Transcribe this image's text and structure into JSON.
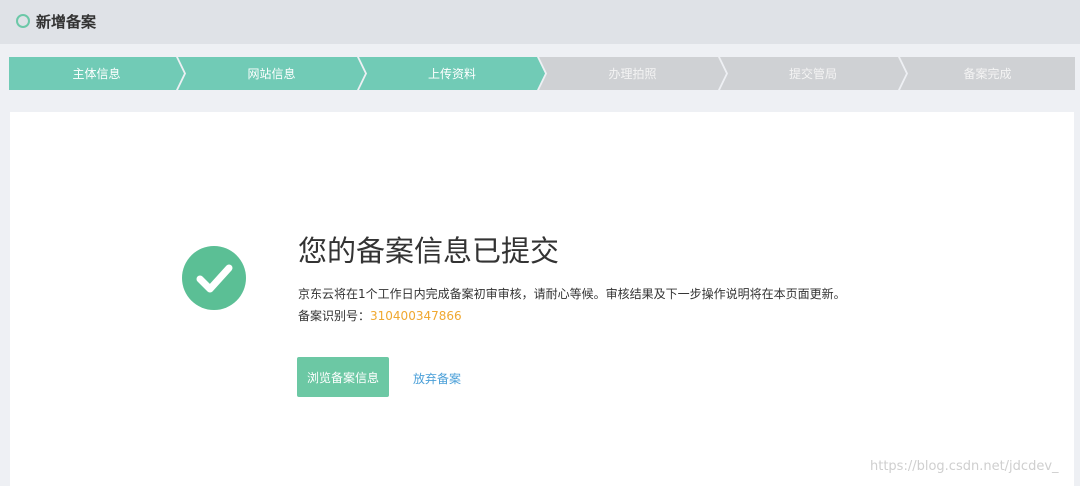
{
  "header": {
    "title": "新增备案"
  },
  "steps": [
    {
      "label": "主体信息",
      "state": "done"
    },
    {
      "label": "网站信息",
      "state": "done"
    },
    {
      "label": "上传资料",
      "state": "done"
    },
    {
      "label": "办理拍照",
      "state": "todo"
    },
    {
      "label": "提交管局",
      "state": "todo"
    },
    {
      "label": "备案完成",
      "state": "todo"
    }
  ],
  "result": {
    "icon": "check-circle-icon",
    "title": "您的备案信息已提交",
    "description": "京东云将在1个工作日内完成备案初审审核，请耐心等候。审核结果及下一步操作说明将在本页面更新。",
    "record_label": "备案识别号：",
    "record_number": "310400347866"
  },
  "actions": {
    "view_label": "浏览备案信息",
    "abandon_label": "放弃备案"
  },
  "watermark": "https://blog.csdn.net/jdcdev_",
  "colors": {
    "step_done": "#71cbb6",
    "step_todo": "#cfd1d4",
    "success": "#5bbf95",
    "record_number": "#f0a830",
    "link": "#4a9fd8"
  }
}
